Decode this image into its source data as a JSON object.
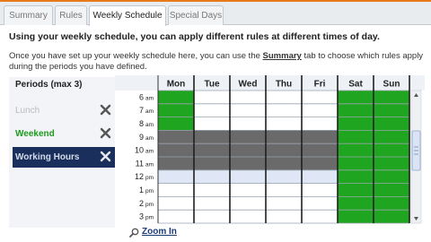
{
  "tabs": [
    "Summary",
    "Rules",
    "Weekly Schedule",
    "Special Days"
  ],
  "headline": "Using your weekly schedule, you can apply different rules at different times of day.",
  "description": {
    "before": "Once you have set up your weekly schedule here, you can use the ",
    "link": "Summary",
    "after": " tab to choose which rules apply during the periods you have defined."
  },
  "periods": {
    "title": "Periods (max 3)",
    "items": [
      {
        "label": "Lunch",
        "state": "inactive"
      },
      {
        "label": "Weekend",
        "state": "normal"
      },
      {
        "label": "Working Hours",
        "state": "selected"
      }
    ]
  },
  "schedule": {
    "days": [
      "Mon",
      "Tue",
      "Wed",
      "Thu",
      "Fri",
      "Sat",
      "Sun"
    ],
    "hours": [
      {
        "num": "6",
        "ampm": "am"
      },
      {
        "num": "7",
        "ampm": "am"
      },
      {
        "num": "8",
        "ampm": "am"
      },
      {
        "num": "9",
        "ampm": "am"
      },
      {
        "num": "10",
        "ampm": "am"
      },
      {
        "num": "11",
        "ampm": "am"
      },
      {
        "num": "12",
        "ampm": "pm"
      },
      {
        "num": "1",
        "ampm": "pm"
      },
      {
        "num": "2",
        "ampm": "pm"
      },
      {
        "num": "3",
        "ampm": "pm"
      }
    ],
    "colors": {
      "weekend": "#1fa51f",
      "working": "#6a6a6a",
      "lunch": "#dfe7f6",
      "empty": "#ffffff"
    },
    "cells": [
      [
        "weekend",
        "empty",
        "empty",
        "empty",
        "empty",
        "weekend",
        "weekend"
      ],
      [
        "weekend",
        "empty",
        "empty",
        "empty",
        "empty",
        "weekend",
        "weekend"
      ],
      [
        "weekend",
        "empty",
        "empty",
        "empty",
        "empty",
        "weekend",
        "weekend"
      ],
      [
        "working",
        "working",
        "working",
        "working",
        "working",
        "weekend",
        "weekend"
      ],
      [
        "working",
        "working",
        "working",
        "working",
        "working",
        "weekend",
        "weekend"
      ],
      [
        "working",
        "working",
        "working",
        "working",
        "working",
        "weekend",
        "weekend"
      ],
      [
        "lunch",
        "lunch",
        "lunch",
        "lunch",
        "lunch",
        "weekend",
        "weekend"
      ],
      [
        "empty",
        "empty",
        "empty",
        "empty",
        "empty",
        "weekend",
        "weekend"
      ],
      [
        "empty",
        "empty",
        "empty",
        "empty",
        "empty",
        "weekend",
        "weekend"
      ],
      [
        "empty",
        "empty",
        "empty",
        "empty",
        "empty",
        "weekend",
        "weekend"
      ]
    ]
  },
  "zoom_label": "Zoom In"
}
